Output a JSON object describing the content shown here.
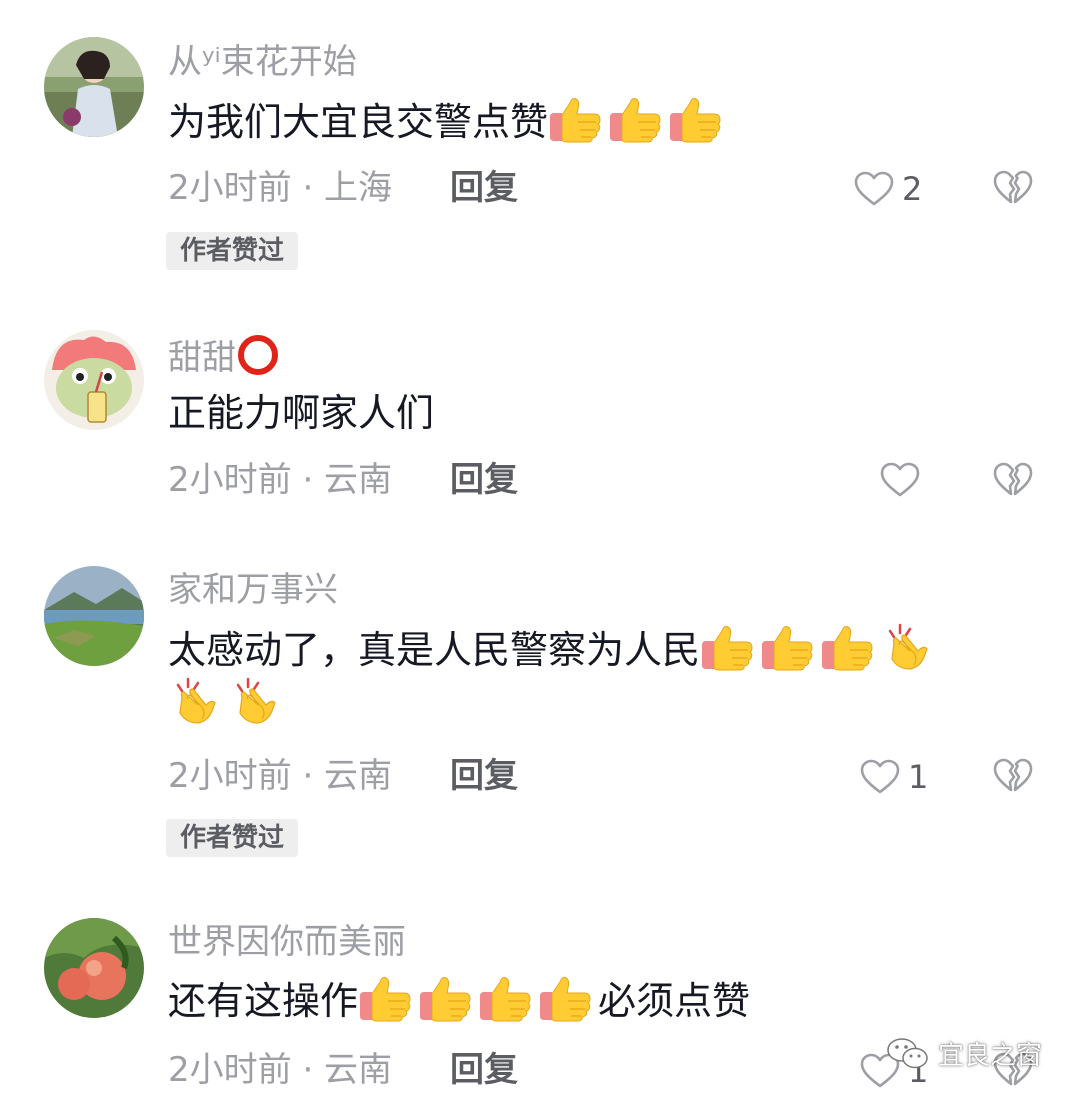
{
  "comments": [
    {
      "username": "从ʸⁱ束花开始",
      "text": "为我们大宜良交警点赞",
      "emojis": [
        "thumbs-up",
        "thumbs-up",
        "thumbs-up"
      ],
      "time": "2小时前 · 上海",
      "reply_label": "回复",
      "like_count": "2",
      "badge": "作者赞过"
    },
    {
      "username": "甜甜",
      "username_suffix": "red-circle-icon",
      "text": "正能力啊家人们",
      "emojis": [],
      "time": "2小时前 · 云南",
      "reply_label": "回复",
      "like_count": "",
      "badge": ""
    },
    {
      "username": "家和万事兴",
      "text": "太感动了，真是人民警察为人民",
      "emojis": [
        "thumbs-up",
        "thumbs-up",
        "thumbs-up",
        "clapping-hands",
        "clapping-hands",
        "clapping-hands"
      ],
      "time": "2小时前 · 云南",
      "reply_label": "回复",
      "like_count": "1",
      "badge": "作者赞过"
    },
    {
      "username": "世界因你而美丽",
      "text": "还有这操作",
      "text_after": "必须点赞",
      "emojis": [
        "thumbs-up",
        "thumbs-up",
        "thumbs-up",
        "thumbs-up"
      ],
      "time": "2小时前 · 云南",
      "reply_label": "回复",
      "like_count": "1",
      "badge": ""
    }
  ],
  "watermark": {
    "label": "宜良之窗",
    "icon": "wechat-icon"
  },
  "colors": {
    "username": "#9d9fa4",
    "text": "#161823",
    "meta": "#9d9fa4",
    "reply": "#5b5d63",
    "badge_bg": "#eeeeef"
  }
}
